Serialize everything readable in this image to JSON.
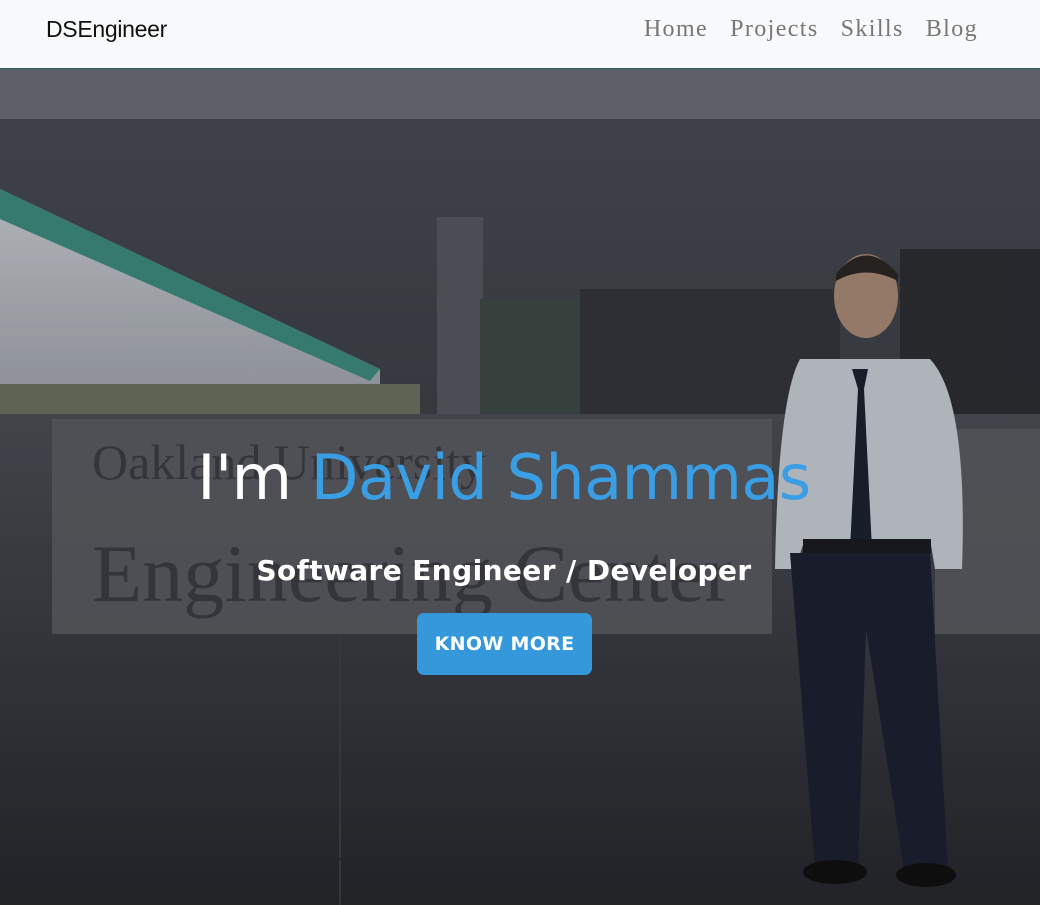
{
  "nav": {
    "brand": "DSEngineer",
    "links": [
      "Home",
      "Projects",
      "Skills",
      "Blog"
    ]
  },
  "hero": {
    "greeting": "I'm",
    "name": "David Shammas",
    "subtitle": "Software Engineer / Developer",
    "cta_label": "KNOW MORE",
    "background_sign_text": [
      "Oakland University",
      "Engineering Center"
    ]
  },
  "colors": {
    "accent": "#3498db",
    "name_text": "#3a9ee4",
    "navbar_bg": "#f8f9fa"
  }
}
